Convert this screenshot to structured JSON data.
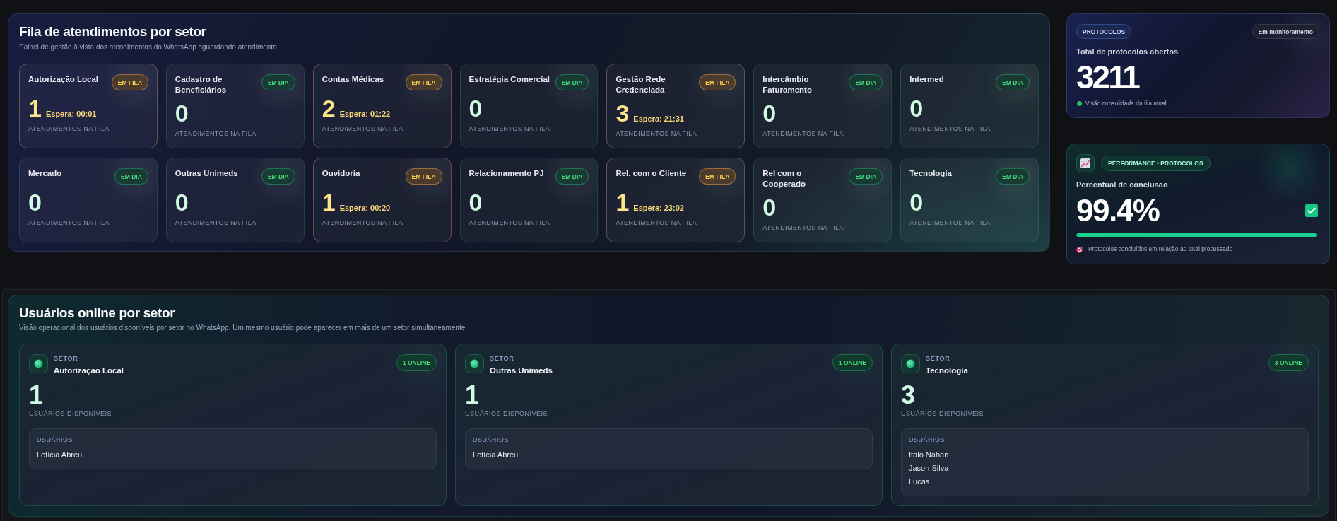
{
  "queue_panel": {
    "title": "Fila de atendimentos por setor",
    "subtitle": "Painel de gestão à vista dos atendimentos do WhatsApp aguardando atendimento",
    "sectors": [
      {
        "name": "Autorização Local",
        "badge": "EM FILA",
        "waiting": true,
        "count": "1",
        "wait_time": "Espera: 00:01",
        "label": "ATENDIMENTOS NA FILA"
      },
      {
        "name": "Cadastro de Beneficiários",
        "badge": "EM DIA",
        "waiting": false,
        "count": "0",
        "label": "ATENDIMENTOS NA FILA"
      },
      {
        "name": "Contas Médicas",
        "badge": "EM FILA",
        "waiting": true,
        "count": "2",
        "wait_time": "Espera: 01:22",
        "label": "ATENDIMENTOS NA FILA"
      },
      {
        "name": "Estratégia Comercial",
        "badge": "EM DIA",
        "waiting": false,
        "count": "0",
        "label": "ATENDIMENTOS NA FILA"
      },
      {
        "name": "Gestão Rede Credenciada",
        "badge": "EM FILA",
        "waiting": true,
        "count": "3",
        "wait_time": "Espera: 21:31",
        "label": "ATENDIMENTOS NA FILA"
      },
      {
        "name": "Intercâmbio Faturamento",
        "badge": "EM DIA",
        "waiting": false,
        "count": "0",
        "label": "ATENDIMENTOS NA FILA"
      },
      {
        "name": "Intermed",
        "badge": "EM DIA",
        "waiting": false,
        "count": "0",
        "label": "ATENDIMENTOS NA FILA"
      },
      {
        "name": "Mercado",
        "badge": "EM DIA",
        "waiting": false,
        "count": "0",
        "label": "ATENDIMENTOS NA FILA"
      },
      {
        "name": "Outras Unimeds",
        "badge": "EM DIA",
        "waiting": false,
        "count": "0",
        "label": "ATENDIMENTOS NA FILA"
      },
      {
        "name": "Ouvidoria",
        "badge": "EM FILA",
        "waiting": true,
        "count": "1",
        "wait_time": "Espera: 00:20",
        "label": "ATENDIMENTOS NA FILA"
      },
      {
        "name": "Relacionamento PJ",
        "badge": "EM DIA",
        "waiting": false,
        "count": "0",
        "label": "ATENDIMENTOS NA FILA"
      },
      {
        "name": "Rel. com o Cliente",
        "badge": "EM FILA",
        "waiting": true,
        "count": "1",
        "wait_time": "Espera: 23:02",
        "label": "ATENDIMENTOS NA FILA"
      },
      {
        "name": "Rel com o Cooperado",
        "badge": "EM DIA",
        "waiting": false,
        "count": "0",
        "label": "ATENDIMENTOS NA FILA"
      },
      {
        "name": "Tecnologia",
        "badge": "EM DIA",
        "waiting": false,
        "count": "0",
        "label": "ATENDIMENTOS NA FILA"
      }
    ]
  },
  "protocols_card": {
    "tag": "PROTOCOLOS",
    "status": "Em monitoramento",
    "title": "Total de protocolos abertos",
    "value": "3211",
    "note": "Visão consolidada da fila atual"
  },
  "performance_card": {
    "tag": "PERFORMANCE • PROTOCOLOS",
    "title": "Percentual de conclusão",
    "value": "99.4%",
    "level": 0.994,
    "note": "Protocolos concluídos em relação ao total processado"
  },
  "online_panel": {
    "title": "Usuários online por setor",
    "subtitle": "Visão operacional dos usuários disponíveis por setor no WhatsApp. Um mesmo usuário pode aparecer em mais de um setor simultaneamente.",
    "sectors": [
      {
        "label": "SETOR",
        "name": "Autorização Local",
        "badge": "1 ONLINE",
        "count": "1",
        "count_label": "USUÁRIOS DISPONÍVEIS",
        "users_label": "USUÁRIOS",
        "users": [
          "Letícia Abreu"
        ]
      },
      {
        "label": "SETOR",
        "name": "Outras Unimeds",
        "badge": "1 ONLINE",
        "count": "1",
        "count_label": "USUÁRIOS DISPONÍVEIS",
        "users_label": "USUÁRIOS",
        "users": [
          "Letícia Abreu"
        ]
      },
      {
        "label": "SETOR",
        "name": "Tecnologia",
        "badge": "3 ONLINE",
        "count": "3",
        "count_label": "USUÁRIOS DISPONÍVEIS",
        "users_label": "USUÁRIOS",
        "users": [
          "Italo Nahan",
          "Jason Silva",
          "Lucas"
        ]
      }
    ]
  }
}
